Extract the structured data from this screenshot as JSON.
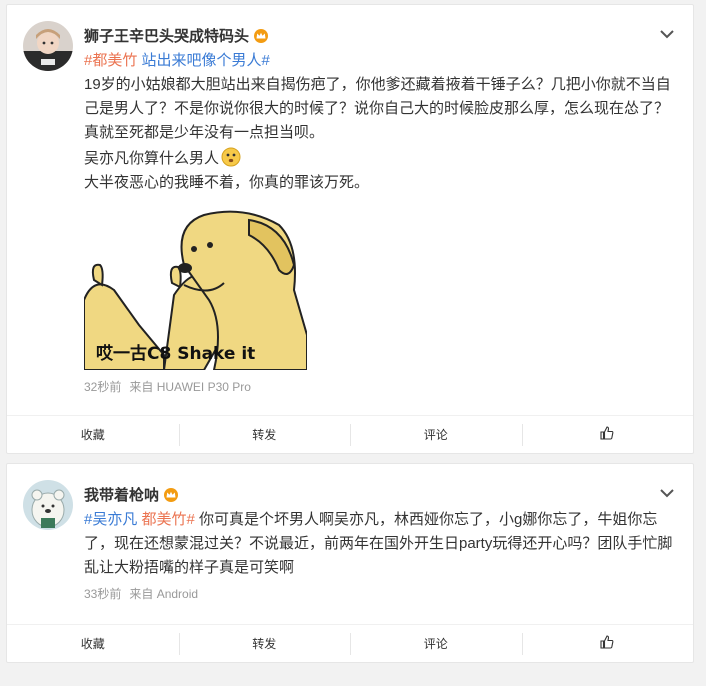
{
  "posts": [
    {
      "username": "狮子王辛巴头哭成特码头",
      "tags": [
        "#都美竹",
        "站出来吧像个男人#"
      ],
      "paragraphs": [
        "19岁的小姑娘都大胆站出来自揭伤疤了，你他爹还藏着掖着干锤子么？几把小你就不当自己是男人了？不是你说你很大的时候了？说你自己大的时候脸皮那么厚，怎么现在怂了？真就至死都是少年没有一点担当呗。",
        "吴亦凡你算什么男人",
        "大半夜恶心的我睡不着，你真的罪该万死。"
      ],
      "sticker_caption": "哎一古C8 Shake it",
      "time": "32秒前",
      "source": "来自 HUAWEI P30 Pro",
      "actions": {
        "fav": "收藏",
        "repost": "转发",
        "comment": "评论"
      }
    },
    {
      "username": "我带着枪呐",
      "tags": [
        "#吴亦凡",
        "都美竹#"
      ],
      "body": "你可真是个坏男人啊吴亦凡，林西娅你忘了，小g娜你忘了，牛姐你忘了，现在还想蒙混过关？不说最近，前两年在国外开生日party玩得还开心吗？团队手忙脚乱让大粉捂嘴的样子真是可笑啊",
      "time": "33秒前",
      "source": "来自 Android",
      "actions": {
        "fav": "收藏",
        "repost": "转发",
        "comment": "评论"
      }
    }
  ],
  "icons": [
    "chevron-down-icon",
    "crown-icon",
    "thumbs-up-icon",
    "thinking-emoji-icon"
  ],
  "colors": {
    "tag": "#eb7350",
    "accent": "#3a7bd5",
    "meta": "#999999"
  }
}
